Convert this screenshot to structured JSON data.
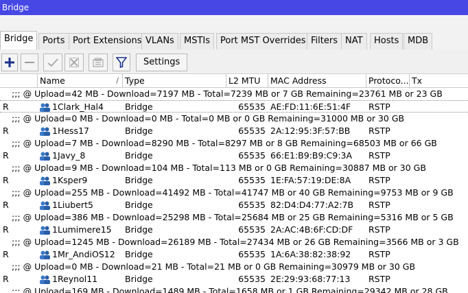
{
  "window": {
    "title": "Bridge"
  },
  "tabs": [
    {
      "label": "Bridge",
      "active": true
    },
    {
      "label": "Ports"
    },
    {
      "label": "Port Extensions"
    },
    {
      "label": "VLANs"
    },
    {
      "label": "MSTIs"
    },
    {
      "label": "Port MST Overrides"
    },
    {
      "label": "Filters"
    },
    {
      "label": "NAT"
    },
    {
      "label": "Hosts"
    },
    {
      "label": "MDB"
    }
  ],
  "toolbar": {
    "icons": [
      "add-icon",
      "remove-icon",
      "enable-icon",
      "disable-icon",
      "comment-icon",
      "filter-icon"
    ],
    "settings_label": "Settings"
  },
  "columns": {
    "name": "Name",
    "type": "Type",
    "mtu": "L2 MTU",
    "mac": "MAC Address",
    "proto": "Protoco...",
    "tx": "Tx"
  },
  "rows": [
    {
      "comment": ";;; @ Upload=42 MB - Download=7197 MB - Total=7239 MB or 7 GB Remaining=23761 MB or 23 GB",
      "flag": "R",
      "name": "1Clark_Hal4",
      "type": "Bridge",
      "mtu": "65535",
      "mac": "AE:FD:11:6E:51:4F",
      "proto": "RSTP"
    },
    {
      "comment": ";;; @ Upload=0 MB - Download=0 MB - Total=0 MB or 0 GB Remaining=31000 MB or 30 GB",
      "flag": "R",
      "name": "1Hess17",
      "type": "Bridge",
      "mtu": "65535",
      "mac": "2A:12:95:3F:57:BB",
      "proto": "RSTP"
    },
    {
      "comment": ";;; @ Upload=7 MB - Download=8290 MB - Total=8297 MB or 8 GB Remaining=68503 MB or 66 GB",
      "flag": "R",
      "name": "1Javy_8",
      "type": "Bridge",
      "mtu": "65535",
      "mac": "66:E1:B9:B9:C9:3A",
      "proto": "RSTP"
    },
    {
      "comment": ";;; @ Upload=9 MB - Download=104 MB - Total=113 MB or 0 GB Remaining=30887 MB or 30 GB",
      "flag": "R",
      "name": "1Ksper9",
      "type": "Bridge",
      "mtu": "65535",
      "mac": "1E:FA:57:19:DE:8A",
      "proto": "RSTP"
    },
    {
      "comment": ";;; @ Upload=255 MB - Download=41492 MB - Total=41747 MB or 40 GB Remaining=9753 MB or 9 GB",
      "flag": "R",
      "name": "1Liubert5",
      "type": "Bridge",
      "mtu": "65535",
      "mac": "82:D4:D4:77:A2:7B",
      "proto": "RSTP"
    },
    {
      "comment": ";;; @ Upload=386 MB - Download=25298 MB - Total=25684 MB or 25 GB Remaining=5316 MB or 5 GB",
      "flag": "R",
      "name": "1Lumimere15",
      "type": "Bridge",
      "mtu": "65535",
      "mac": "2A:AC:4B:6F:CD:DF",
      "proto": "RSTP"
    },
    {
      "comment": ";;; @ Upload=1245 MB - Download=26189 MB - Total=27434 MB or 26 GB Remaining=3566 MB or 3 GB",
      "flag": "R",
      "name": "1Mr_AndiOS12",
      "type": "Bridge",
      "mtu": "65535",
      "mac": "1A:6A:38:82:38:92",
      "proto": "RSTP"
    },
    {
      "comment": ";;; @ Upload=0 MB - Download=21 MB - Total=21 MB or 0 GB Remaining=30979 MB or 30 GB",
      "flag": "R",
      "name": "1Reynol11",
      "type": "Bridge",
      "mtu": "65535",
      "mac": "2E:29:93:68:77:13",
      "proto": "RSTP"
    },
    {
      "comment": ";;; @ Upload=169 MB - Download=1489 MB - Total=1658 MB or 1 GB Remaining=29342 MB or 28 GB"
    }
  ]
}
